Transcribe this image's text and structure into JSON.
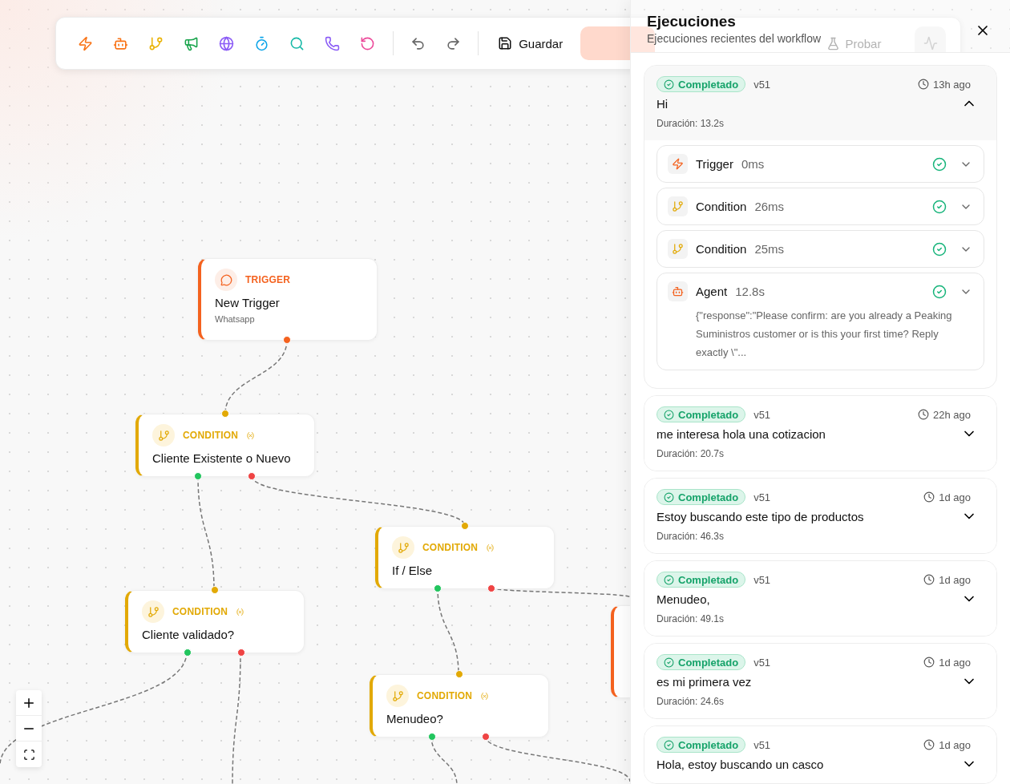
{
  "toolbar": {
    "tools": [
      {
        "kind": "trigger",
        "color": "#f97316"
      },
      {
        "kind": "agent",
        "color": "#f97316"
      },
      {
        "kind": "condition",
        "color": "#eab308"
      },
      {
        "kind": "announce",
        "color": "#16a34a"
      },
      {
        "kind": "web",
        "color": "#8b5cf6"
      },
      {
        "kind": "timer",
        "color": "#0ea5e9"
      },
      {
        "kind": "search",
        "color": "#14b8a6"
      },
      {
        "kind": "call",
        "color": "#8b5cf6"
      },
      {
        "kind": "loop",
        "color": "#ec4899"
      }
    ],
    "save_label": "Guardar",
    "test_label": "Probar"
  },
  "canvas": {
    "nodes": [
      {
        "kind": "trigger",
        "type_label": "TRIGGER",
        "title": "New Trigger",
        "subtitle": "Whatsapp"
      },
      {
        "kind": "condition",
        "type_label": "CONDITION",
        "title": "Cliente Existente o Nuevo"
      },
      {
        "kind": "condition",
        "type_label": "CONDITION",
        "title": "If / Else"
      },
      {
        "kind": "condition",
        "type_label": "CONDITION",
        "title": "Cliente validado?"
      },
      {
        "kind": "condition",
        "type_label": "CONDITION",
        "title": "Menudeo?"
      },
      {
        "kind": "fallback"
      }
    ]
  },
  "panel": {
    "title": "Ejecuciones",
    "subtitle": "Ejecuciones recientes del workflow",
    "runs": [
      {
        "status_label": "Completado",
        "version": "v51",
        "time": "13h ago",
        "message": "Hi",
        "duration": "Duración: 13.2s",
        "expanded": true,
        "steps": [
          {
            "kind": "trigger",
            "name": "Trigger",
            "time": "0ms"
          },
          {
            "kind": "condition",
            "name": "Condition",
            "time": "26ms"
          },
          {
            "kind": "condition",
            "name": "Condition",
            "time": "25ms"
          },
          {
            "kind": "agent",
            "name": "Agent",
            "time": "12.8s",
            "output": "{\"response\":\"Please confirm: are you already a Peaking Suministros customer or is this your first time? Reply exactly \\\"..."
          }
        ]
      },
      {
        "status_label": "Completado",
        "version": "v51",
        "time": "22h ago",
        "message": "me interesa hola una cotizacion",
        "duration": "Duración: 20.7s",
        "expanded": false
      },
      {
        "status_label": "Completado",
        "version": "v51",
        "time": "1d ago",
        "message": "Estoy buscando este tipo de productos",
        "duration": "Duración: 46.3s",
        "expanded": false
      },
      {
        "status_label": "Completado",
        "version": "v51",
        "time": "1d ago",
        "message": "Menudeo,",
        "duration": "Duración: 49.1s",
        "expanded": false
      },
      {
        "status_label": "Completado",
        "version": "v51",
        "time": "1d ago",
        "message": "es mi primera vez",
        "duration": "Duración: 24.6s",
        "expanded": false
      },
      {
        "status_label": "Completado",
        "version": "v51",
        "time": "1d ago",
        "message": "Hola, estoy buscando un casco",
        "expanded": false
      }
    ]
  }
}
